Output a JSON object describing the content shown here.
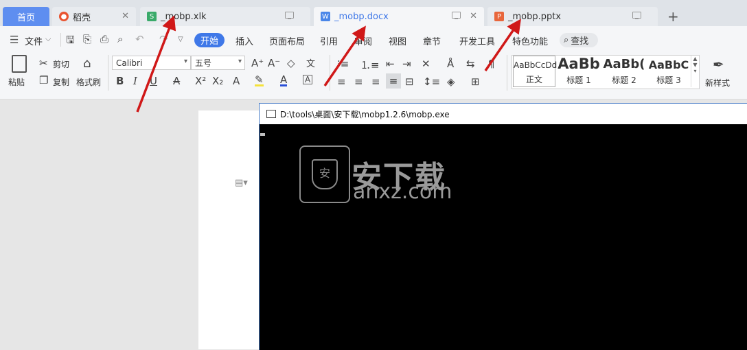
{
  "tabs": {
    "home": "首页",
    "daoke": "稻壳",
    "xlk": "_mobp.xlk",
    "docx": "_mobp.docx",
    "pptx": "_mobp.pptx"
  },
  "menu": {
    "file": "文件",
    "start": "开始",
    "insert": "插入",
    "layout": "页面布局",
    "reference": "引用",
    "review": "审阅",
    "view": "视图",
    "chapter": "章节",
    "devtools": "开发工具",
    "special": "特色功能",
    "search": "查找"
  },
  "ribbon": {
    "paste": "粘贴",
    "cut": "剪切",
    "copy": "复制",
    "format_painter": "格式刷",
    "font_name": "Calibri",
    "font_size": "五号",
    "new_style": "新样式"
  },
  "styles": [
    {
      "preview": "AaBbCcDd",
      "label": "正文"
    },
    {
      "preview": "AaBb",
      "label": "标题 1"
    },
    {
      "preview": "AaBb(",
      "label": "标题 2"
    },
    {
      "preview": "AaBbC",
      "label": "标题 3"
    }
  ],
  "console": {
    "title": "D:\\tools\\桌面\\安下载\\mobp1.2.6\\mobp.exe"
  },
  "watermark": {
    "name": "安下载",
    "domain": "anxz.com",
    "shield_char": "安"
  },
  "colors": {
    "accent": "#3f78e8",
    "arrow": "#d01818",
    "home_tab": "#5e8ef0"
  }
}
